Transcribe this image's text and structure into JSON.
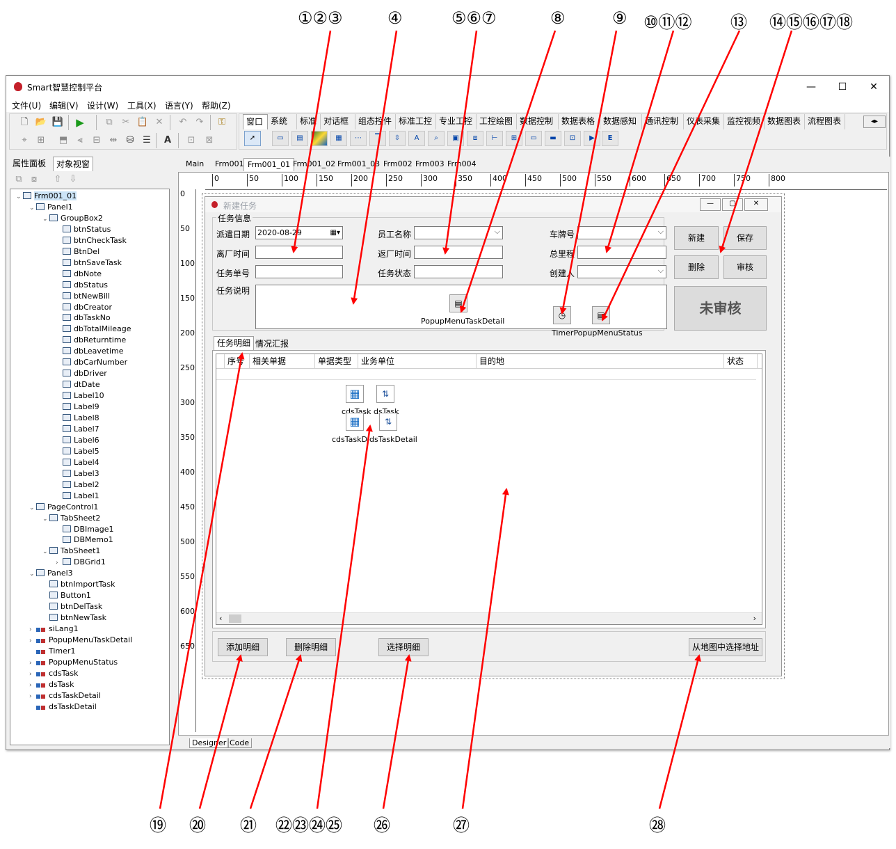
{
  "markers": {
    "top": [
      "①②③",
      "④",
      "⑤⑥⑦",
      "⑧",
      "⑨",
      "⑩⑪⑫",
      "⑬",
      "⑭⑮⑯⑰⑱"
    ],
    "bottom": [
      "⑲",
      "⑳",
      "㉑",
      "㉒㉓㉔㉕",
      "㉖",
      "㉗",
      "㉘"
    ]
  },
  "window": {
    "title": "Smart智慧控制平台",
    "menu": [
      "文件(U)",
      "编辑(V)",
      "设计(W)",
      "工具(X)",
      "语言(Y)",
      "帮助(Z)"
    ],
    "controls": {
      "minimize": "—",
      "maximize": "☐",
      "close": "✕"
    }
  },
  "component_tabs": [
    "窗口",
    "系统",
    "标准",
    "对话框",
    "组态控件",
    "标准工控",
    "专业工控",
    "工控绘图",
    "数据控制",
    "数据表格",
    "数据感知",
    "通讯控制",
    "仪表采集",
    "监控视频",
    "数据图表",
    "流程图表"
  ],
  "component_tab_arrows": "◂▸",
  "left_panel": {
    "tabs": [
      "属性面板",
      "对象视窗"
    ],
    "tree": [
      {
        "label": "Frm001_01",
        "level": 0,
        "exp": "⌄",
        "kind": "form"
      },
      {
        "label": "Panel1",
        "level": 1,
        "exp": "⌄",
        "kind": "ctl"
      },
      {
        "label": "GroupBox2",
        "level": 2,
        "exp": "⌄",
        "kind": "ctl"
      },
      {
        "label": "btnStatus",
        "level": 3,
        "exp": "",
        "kind": "ctl"
      },
      {
        "label": "btnCheckTask",
        "level": 3,
        "exp": "",
        "kind": "ctl"
      },
      {
        "label": "BtnDel",
        "level": 3,
        "exp": "",
        "kind": "ctl"
      },
      {
        "label": "btnSaveTask",
        "level": 3,
        "exp": "",
        "kind": "ctl"
      },
      {
        "label": "dbNote",
        "level": 3,
        "exp": "",
        "kind": "ctl"
      },
      {
        "label": "dbStatus",
        "level": 3,
        "exp": "",
        "kind": "ctl"
      },
      {
        "label": "btNewBill",
        "level": 3,
        "exp": "",
        "kind": "ctl"
      },
      {
        "label": "dbCreator",
        "level": 3,
        "exp": "",
        "kind": "ctl"
      },
      {
        "label": "dbTaskNo",
        "level": 3,
        "exp": "",
        "kind": "ctl"
      },
      {
        "label": "dbTotalMileage",
        "level": 3,
        "exp": "",
        "kind": "ctl"
      },
      {
        "label": "dbReturntime",
        "level": 3,
        "exp": "",
        "kind": "ctl"
      },
      {
        "label": "dbLeavetime",
        "level": 3,
        "exp": "",
        "kind": "ctl"
      },
      {
        "label": "dbCarNumber",
        "level": 3,
        "exp": "",
        "kind": "ctl"
      },
      {
        "label": "dbDriver",
        "level": 3,
        "exp": "",
        "kind": "ctl"
      },
      {
        "label": "dtDate",
        "level": 3,
        "exp": "",
        "kind": "ctl"
      },
      {
        "label": "Label10",
        "level": 3,
        "exp": "",
        "kind": "ctl"
      },
      {
        "label": "Label9",
        "level": 3,
        "exp": "",
        "kind": "ctl"
      },
      {
        "label": "Label8",
        "level": 3,
        "exp": "",
        "kind": "ctl"
      },
      {
        "label": "Label7",
        "level": 3,
        "exp": "",
        "kind": "ctl"
      },
      {
        "label": "Label6",
        "level": 3,
        "exp": "",
        "kind": "ctl"
      },
      {
        "label": "Label5",
        "level": 3,
        "exp": "",
        "kind": "ctl"
      },
      {
        "label": "Label4",
        "level": 3,
        "exp": "",
        "kind": "ctl"
      },
      {
        "label": "Label3",
        "level": 3,
        "exp": "",
        "kind": "ctl"
      },
      {
        "label": "Label2",
        "level": 3,
        "exp": "",
        "kind": "ctl"
      },
      {
        "label": "Label1",
        "level": 3,
        "exp": "",
        "kind": "ctl"
      },
      {
        "label": "PageControl1",
        "level": 1,
        "exp": "⌄",
        "kind": "ctl"
      },
      {
        "label": "TabSheet2",
        "level": 2,
        "exp": "⌄",
        "kind": "ctl"
      },
      {
        "label": "DBImage1",
        "level": 3,
        "exp": "",
        "kind": "ctl"
      },
      {
        "label": "DBMemo1",
        "level": 3,
        "exp": "",
        "kind": "ctl"
      },
      {
        "label": "TabSheet1",
        "level": 2,
        "exp": "⌄",
        "kind": "ctl"
      },
      {
        "label": "DBGrid1",
        "level": 3,
        "exp": "›",
        "kind": "ctl"
      },
      {
        "label": "Panel3",
        "level": 1,
        "exp": "⌄",
        "kind": "ctl"
      },
      {
        "label": "btnImportTask",
        "level": 2,
        "exp": "",
        "kind": "ctl"
      },
      {
        "label": "Button1",
        "level": 2,
        "exp": "",
        "kind": "ctl"
      },
      {
        "label": "btnDelTask",
        "level": 2,
        "exp": "",
        "kind": "ctl"
      },
      {
        "label": "btnNewTask",
        "level": 2,
        "exp": "",
        "kind": "ctl"
      },
      {
        "label": "siLang1",
        "level": 1,
        "exp": "›",
        "kind": "comp"
      },
      {
        "label": "PopupMenuTaskDetail",
        "level": 1,
        "exp": "›",
        "kind": "comp"
      },
      {
        "label": "Timer1",
        "level": 1,
        "exp": "",
        "kind": "comp"
      },
      {
        "label": "PopupMenuStatus",
        "level": 1,
        "exp": "›",
        "kind": "comp"
      },
      {
        "label": "cdsTask",
        "level": 1,
        "exp": "›",
        "kind": "comp"
      },
      {
        "label": "dsTask",
        "level": 1,
        "exp": "›",
        "kind": "comp"
      },
      {
        "label": "cdsTaskDetail",
        "level": 1,
        "exp": "›",
        "kind": "comp"
      },
      {
        "label": "dsTaskDetail",
        "level": 1,
        "exp": "",
        "kind": "comp"
      }
    ]
  },
  "designer": {
    "tabs": [
      "Main",
      "Frm001",
      "Frm001_01",
      "Frm001_02",
      "Frm001_03",
      "Frm002",
      "Frm003",
      "Frm004"
    ],
    "active_tab": "Frm001_01",
    "ruler_h": [
      "0",
      "50",
      "100",
      "150",
      "200",
      "250",
      "300",
      "350",
      "400",
      "450",
      "500",
      "550",
      "600",
      "650",
      "700",
      "750",
      "800"
    ],
    "ruler_v": [
      "0",
      "50",
      "100",
      "150",
      "200",
      "250",
      "300",
      "350",
      "400",
      "450",
      "500",
      "550",
      "600",
      "650"
    ],
    "bottom_tabs": [
      "Designer",
      "Code"
    ]
  },
  "form": {
    "title": "新建任务",
    "groupbox": "任务信息",
    "labels": {
      "dispatch_date": "派遣日期",
      "leave_time": "离厂时间",
      "task_no": "任务单号",
      "task_desc": "任务说明",
      "employee": "员工名称",
      "return_time": "返厂时间",
      "task_status": "任务状态",
      "car_number": "车牌号",
      "total_mileage": "总里程",
      "creator": "创建人"
    },
    "date_value": "2020-08-29",
    "buttons": {
      "new": "新建",
      "save": "保存",
      "delete": "删除",
      "audit": "审核",
      "status": "未审核"
    },
    "nonvisual": {
      "popup_task_detail": "PopupMenuTaskDetail",
      "timer_popup_status": "TimerPopupMenuStatus",
      "cds_task": "cdsTask",
      "ds_task": "dsTask",
      "cds_task_detail": "cdsTaskD",
      "ds_task_detail": "dsTaskDetail"
    },
    "page_tabs": [
      "任务明细",
      "情况汇报"
    ],
    "grid_columns": [
      "序号",
      "相关单据",
      "单据类型",
      "业务单位",
      "目的地",
      "状态"
    ],
    "bottom_buttons": {
      "add": "添加明细",
      "delete": "删除明细",
      "select": "选择明细",
      "from_map": "从地图中选择地址"
    }
  },
  "colors": {
    "annotation_arrow": "#ff0000",
    "status_text": "#555555"
  }
}
